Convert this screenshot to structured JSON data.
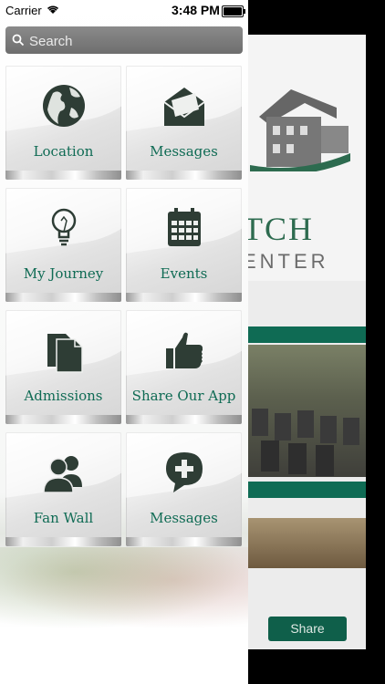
{
  "status_bar": {
    "carrier": "Carrier",
    "time": "3:48 PM"
  },
  "search": {
    "placeholder": "Search"
  },
  "tiles": [
    {
      "label": "Location",
      "icon": "globe-icon"
    },
    {
      "label": "Messages",
      "icon": "envelope-icon"
    },
    {
      "label": "My Journey",
      "icon": "lightbulb-icon"
    },
    {
      "label": "Events",
      "icon": "calendar-icon"
    },
    {
      "label": "Admissions",
      "icon": "documents-icon"
    },
    {
      "label": "Share Our App",
      "icon": "thumbs-up-icon"
    },
    {
      "label": "Fan Wall",
      "icon": "people-icon"
    },
    {
      "label": "Messages",
      "icon": "chat-plus-icon"
    }
  ],
  "background_app": {
    "logo_text": "TCH",
    "logo_subtext": "ENTER",
    "share_label": "Share",
    "accent_color": "#0f6b54"
  },
  "colors": {
    "accent": "#0f6b54",
    "icon": "#2e3d35"
  }
}
